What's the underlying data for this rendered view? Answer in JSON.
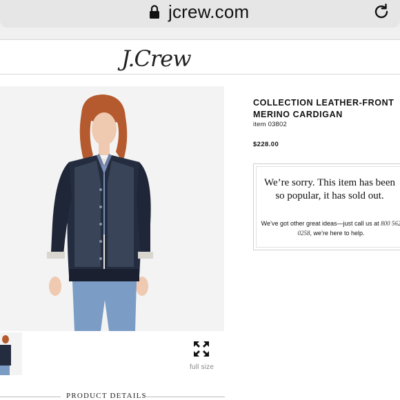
{
  "browser": {
    "url": "jcrew.com"
  },
  "header": {
    "logo": "J.Crew"
  },
  "product": {
    "title": "COLLECTION LEATHER-FRONT MERINO CARDIGAN",
    "item_number": "item 03802",
    "price": "$228.00",
    "full_size_label": "full size",
    "details_label": "PRODUCT DETAILS"
  },
  "soldout": {
    "heading": "We’re sorry. This item has been so popular, it has sold out.",
    "message_before": "We’ve got other great ideas—just call us at ",
    "phone": "800 562 0258",
    "message_after": ", we’re here to help."
  }
}
